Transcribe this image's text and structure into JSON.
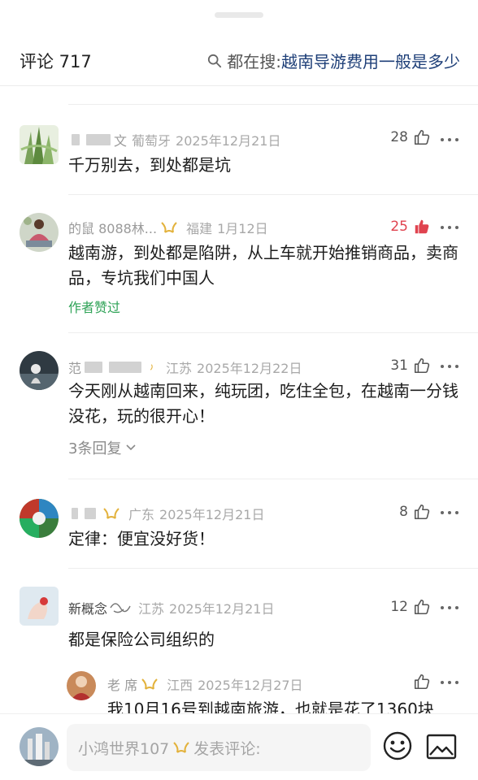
{
  "header": {
    "title": "评论 717",
    "search_prefix": "都在搜:",
    "search_query": "越南导游费用一般是多少"
  },
  "comments": [
    {
      "user_visible": "文",
      "location": "葡萄牙",
      "date": "2025年12月21日",
      "likes": "28",
      "text": "千万别去，到处都是坑"
    },
    {
      "user_visible": "的鼠 8088林...",
      "location": "福建",
      "date": "1月12日",
      "likes": "25",
      "text": "越南游，到处都是陷阱，从上车就开始推销商品，卖商品，专坑我们中国人",
      "author_liked": "作者赞过"
    },
    {
      "user_visible": "范",
      "location": "江苏",
      "date": "2025年12月22日",
      "likes": "31",
      "text": "今天刚从越南回来，纯玩团，吃住全包，在越南一分钱没花，玩的很开心！",
      "replies": "3条回复"
    },
    {
      "user_visible": "",
      "location": "广东",
      "date": "2025年12月21日",
      "likes": "8",
      "text": "定律：便宜没好货！"
    },
    {
      "user_visible": "新概念",
      "location": "江苏",
      "date": "2025年12月21日",
      "likes": "12",
      "text": "都是保险公司组织的"
    }
  ],
  "sub_reply": {
    "user_visible": "老 席",
    "location": "江西",
    "date": "2025年12月27日",
    "text": "我10月16号到越南旅游，也就是花了1360块"
  },
  "composer": {
    "username": "小鸿世界107",
    "placeholder": "发表评论:"
  },
  "colors": {
    "accent_green": "#2fa357",
    "liked_red": "#e0434f",
    "search_query_blue": "#1e3f78"
  }
}
